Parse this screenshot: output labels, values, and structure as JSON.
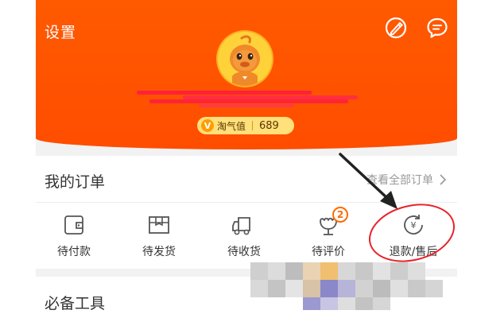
{
  "header": {
    "settings_label": "设置",
    "bg_color": "#ff5000",
    "icons": [
      "edit-icon",
      "message-icon"
    ]
  },
  "profile": {
    "avatar_icon": "mascot-avatar",
    "points_label": "淘气值",
    "points_value": "689"
  },
  "orders": {
    "title": "我的订单",
    "view_all_label": "查看全部订单",
    "items": [
      {
        "label": "待付款",
        "icon": "wallet-icon"
      },
      {
        "label": "待发货",
        "icon": "package-icon"
      },
      {
        "label": "待收货",
        "icon": "truck-icon"
      },
      {
        "label": "待评价",
        "icon": "review-icon",
        "badge": "2"
      },
      {
        "label": "退款/售后",
        "icon": "refund-icon"
      }
    ]
  },
  "tools": {
    "title": "必备工具"
  },
  "annotation": {
    "color": "#e8222a"
  }
}
